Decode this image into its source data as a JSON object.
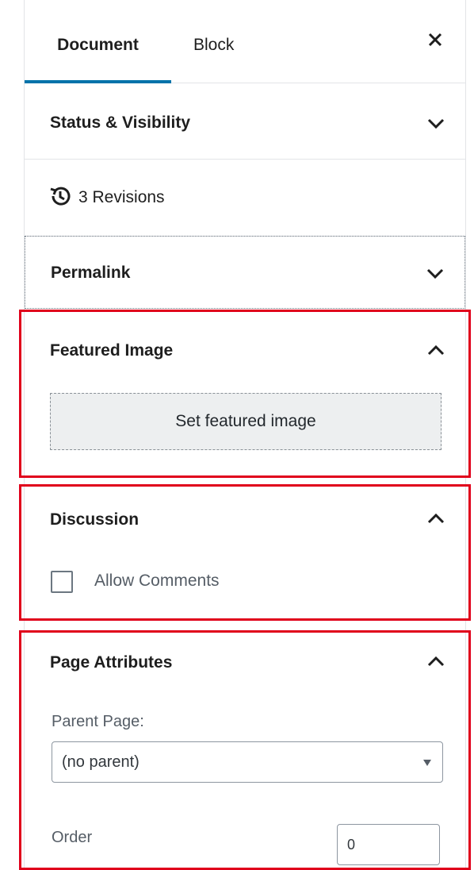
{
  "tabs": {
    "document": "Document",
    "block": "Block"
  },
  "panels": {
    "status": "Status & Visibility",
    "revisions": "3 Revisions",
    "permalink": "Permalink",
    "featured": {
      "title": "Featured Image",
      "button": "Set featured image"
    },
    "discussion": {
      "title": "Discussion",
      "checkbox_label": "Allow Comments",
      "checked": false
    },
    "page_attributes": {
      "title": "Page Attributes",
      "parent_label": "Parent Page:",
      "parent_value": "(no parent)",
      "order_label": "Order",
      "order_value": "0"
    }
  },
  "colors": {
    "accent": "#0073aa",
    "highlight": "#e0001b"
  }
}
